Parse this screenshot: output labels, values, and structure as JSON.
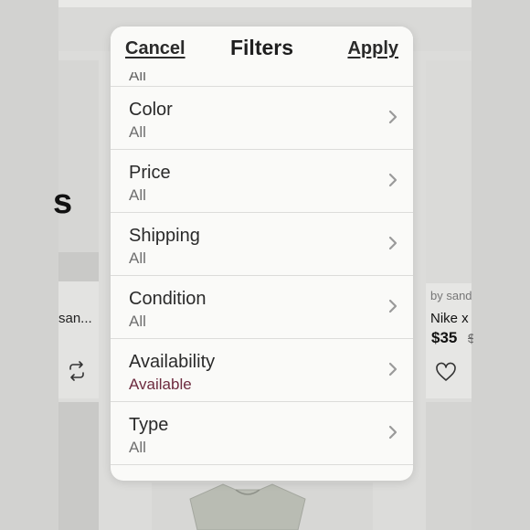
{
  "background": {
    "left_card": {
      "title": "san..."
    },
    "right_card": {
      "byline": "by sand",
      "title": "Nike x",
      "price": "$35",
      "old_price": "$"
    }
  },
  "filters": {
    "cancel_label": "Cancel",
    "title": "Filters",
    "apply_label": "Apply",
    "partial_row_value": "All",
    "rows": [
      {
        "label": "Color",
        "value": "All"
      },
      {
        "label": "Price",
        "value": "All"
      },
      {
        "label": "Shipping",
        "value": "All"
      },
      {
        "label": "Condition",
        "value": "All"
      },
      {
        "label": "Availability",
        "value": "Available"
      },
      {
        "label": "Type",
        "value": "All"
      }
    ]
  },
  "colors": {
    "accent_value": "#6d2b3f",
    "sheet_bg": "#fafaf8"
  }
}
